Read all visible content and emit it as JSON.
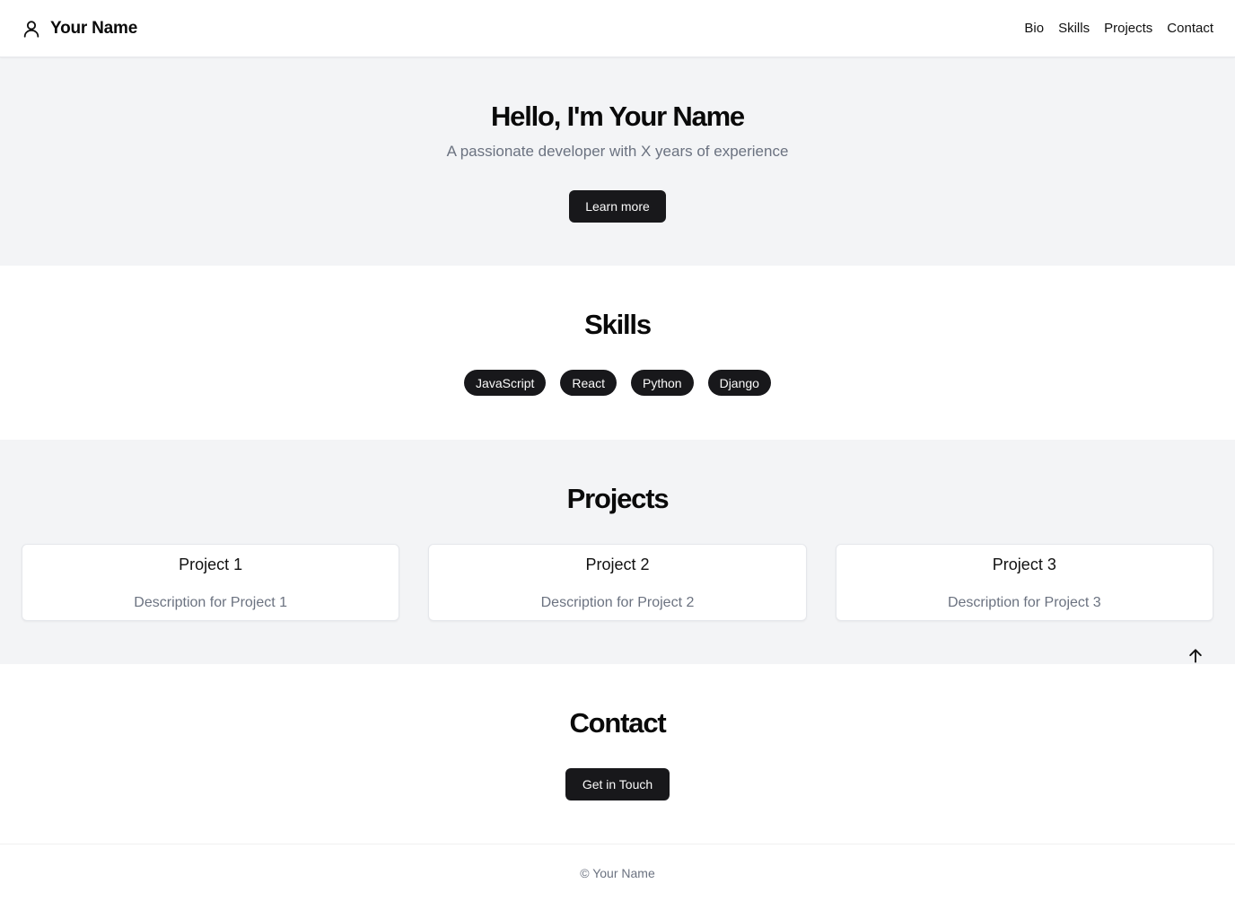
{
  "header": {
    "brand": "Your Name",
    "brand_icon": "user-icon",
    "nav": [
      "Bio",
      "Skills",
      "Projects",
      "Contact"
    ]
  },
  "hero": {
    "title": "Hello, I'm Your Name",
    "subtitle": "A passionate developer with X years of experience",
    "button": "Learn more"
  },
  "skills": {
    "title": "Skills",
    "items": [
      "JavaScript",
      "React",
      "Python",
      "Django"
    ]
  },
  "projects": {
    "title": "Projects",
    "items": [
      {
        "title": "Project 1",
        "description": "Description for Project 1"
      },
      {
        "title": "Project 2",
        "description": "Description for Project 2"
      },
      {
        "title": "Project 3",
        "description": "Description for Project 3"
      }
    ]
  },
  "scroll_top": {
    "icon": "arrow-up-icon"
  },
  "contact": {
    "title": "Contact",
    "button": "Get in Touch"
  },
  "footer": {
    "text": "© Your Name"
  },
  "colors": {
    "dark": "#18181b",
    "muted_bg": "#f3f4f6",
    "muted_text": "#6b7280"
  }
}
